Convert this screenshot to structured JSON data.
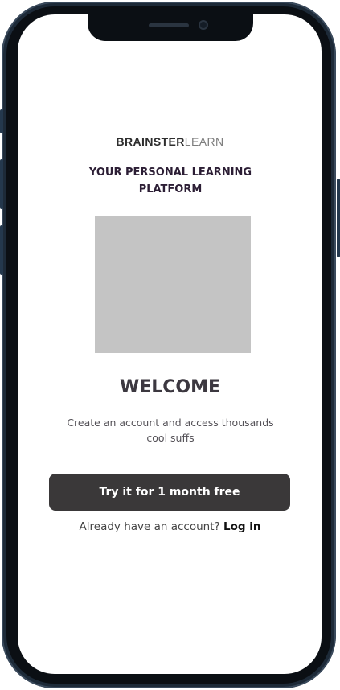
{
  "brand": {
    "bold": "BRAINSTER",
    "light": "LEARN"
  },
  "tagline": "YOUR PERSONAL LEARNING PLATFORM",
  "welcome": {
    "title": "WELCOME",
    "subtitle": "Create an account and access thousands cool suffs"
  },
  "cta": {
    "label": "Try it for 1 month free"
  },
  "login": {
    "prompt": "Already have an account?",
    "link_label": "Log in"
  },
  "colors": {
    "button_bg": "#3a3839",
    "placeholder": "#c4c4c4",
    "tagline": "#2c1e35"
  }
}
